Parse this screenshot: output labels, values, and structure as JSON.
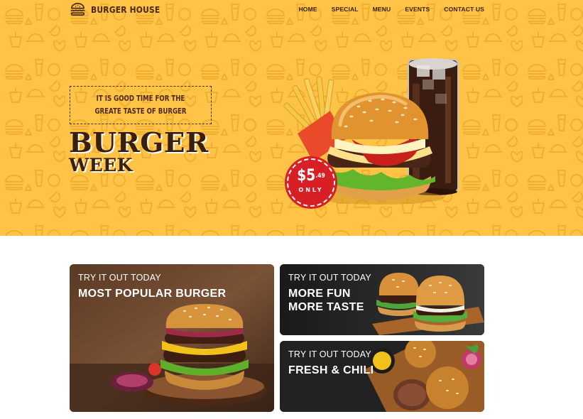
{
  "brand": {
    "name": "BURGER HOUSE",
    "icon": "burger-icon",
    "color": "#4a2a12"
  },
  "nav": {
    "items": [
      {
        "label": "HOME"
      },
      {
        "label": "SPECIAL"
      },
      {
        "label": "MENU"
      },
      {
        "label": "EVENTS"
      },
      {
        "label": "CONTACT US"
      }
    ]
  },
  "hero": {
    "background": "#fec347",
    "tagline": "IT IS GOOD TIME FOR THE GREATE TASTE OF BURGER",
    "headline_line1": "BURGER",
    "headline_line2": "WEEK",
    "price": {
      "dollars": "$5",
      "cents": ".49",
      "label": "ONLY",
      "color": "#d71f25"
    }
  },
  "cards": [
    {
      "eyebrow": "TRY IT OUT TODAY",
      "title": "MOST POPULAR BURGER"
    },
    {
      "eyebrow": "TRY IT OUT TODAY",
      "title_line1": "MORE FUN",
      "title_line2": "MORE TASTE"
    },
    {
      "eyebrow": "TRY IT OUT TODAY",
      "title": "FRESH & CHILI"
    }
  ]
}
